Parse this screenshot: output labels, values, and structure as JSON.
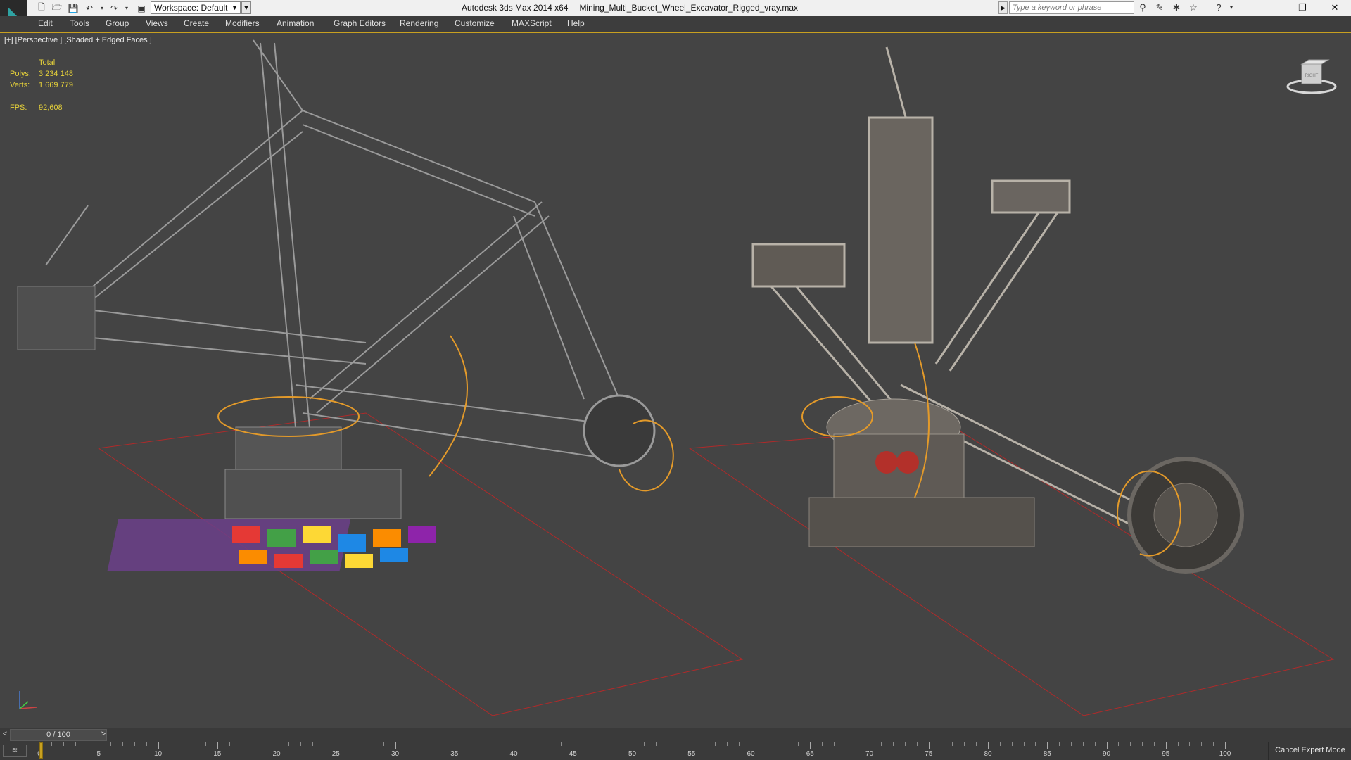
{
  "titlebar": {
    "workspace_label": "Workspace: Default",
    "app_title": "Autodesk 3ds Max  2014 x64",
    "file_name": "Mining_Multi_Bucket_Wheel_Excavator_Rigged_vray.max",
    "search_placeholder": "Type a keyword or phrase",
    "minimize": "—",
    "restore": "❐",
    "close": "✕"
  },
  "menu": {
    "items": [
      "Edit",
      "Tools",
      "Group",
      "Views",
      "Create",
      "Modifiers",
      "Animation",
      "Graph Editors",
      "Rendering",
      "Customize",
      "MAXScript",
      "Help"
    ]
  },
  "viewport": {
    "label": "[+] [Perspective ] [Shaded + Edged Faces ]",
    "stats": {
      "header": "Total",
      "polys_label": "Polys:",
      "polys_value": "3 234 148",
      "verts_label": "Verts:",
      "verts_value": "1 669 779",
      "fps_label": "FPS:",
      "fps_value": "92,608"
    },
    "viewcube_label": "RIGHT"
  },
  "timeslider": {
    "frame_display": "0 / 100",
    "prev": "<",
    "next": ">"
  },
  "trackbar": {
    "ticks": [
      "0",
      "5",
      "10",
      "15",
      "20",
      "25",
      "30",
      "35",
      "40",
      "45",
      "50",
      "55",
      "60",
      "65",
      "70",
      "75",
      "80",
      "85",
      "90",
      "95",
      "100"
    ],
    "current_frame": 0
  },
  "status": {
    "cancel_expert_mode": "Cancel Expert Mode"
  },
  "colors": {
    "viewport_bg": "#444444",
    "stats_yellow": "#e8d33a",
    "grid_red": "#b02a2a",
    "gizmo_orange": "#e39a2a",
    "accent_teal": "#2fa3a3"
  }
}
